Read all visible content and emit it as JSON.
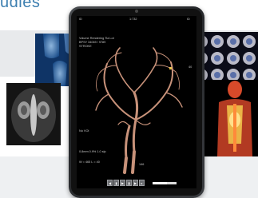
{
  "heading": "udies",
  "viewer": {
    "top_left_id": "ID",
    "top_center": "1:732",
    "top_right": "ID",
    "title_line1": "Volume Rendering  Tia Lot",
    "title_line2": "BPSY 34069 / 9789",
    "title_line3": "STROKE",
    "side_marker": "40",
    "left_label": "No VOI",
    "info_line1": "0.8mm 0.9% 1.0 slp",
    "info_line2": "W = 465  L = 40",
    "bottom_right": "146"
  },
  "toolbar": {
    "buttons": [
      "◀",
      "▮",
      "▶",
      "▮",
      "▶",
      "▸"
    ]
  },
  "colors": {
    "accent": "#3d7fb0",
    "vessel": "#c8927a"
  }
}
